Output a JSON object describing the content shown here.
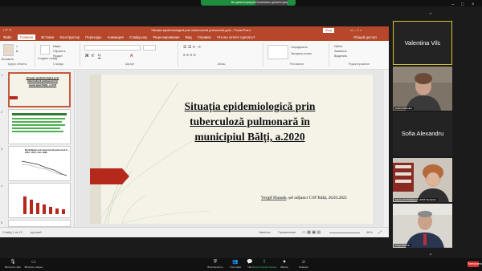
{
  "zoom": {
    "sharing_text": "Вы демонстрируете экран",
    "stop_share_label": "Остановить демонстрацию",
    "bottom_buttons": [
      {
        "icon": "mic-off-icon",
        "label": "Включить звук"
      },
      {
        "icon": "video-off-icon",
        "label": "Включить видео"
      },
      {
        "icon": "security-icon",
        "label": "Безопасность"
      },
      {
        "icon": "participants-icon",
        "label": "Участники"
      },
      {
        "icon": "chat-icon",
        "label": "Чат"
      },
      {
        "icon": "share-screen-icon",
        "label": "Демонстрация экрана"
      },
      {
        "icon": "record-icon",
        "label": "Запись"
      },
      {
        "icon": "reactions-icon",
        "label": "Реакции"
      }
    ],
    "end_label": "Завершить"
  },
  "participants": [
    {
      "name": "Valentina Vilc",
      "label": "",
      "type": "name-only",
      "active": true
    },
    {
      "name": "",
      "label": "Andrei Barbulat",
      "type": "video"
    },
    {
      "name": "Sofia Alexandru",
      "label": "",
      "type": "name-only"
    },
    {
      "name": "",
      "label": "Marina ROTARENCO, IMSP Mediclub",
      "type": "video"
    },
    {
      "name": "",
      "label": "Vergil Manole",
      "type": "video"
    }
  ],
  "ppt": {
    "window_title": "Situația epidemiologică prin tuberculoză pulmonară.pptx - PowerPoint",
    "signin": "Вход",
    "menu": [
      "Файл",
      "Главная",
      "Вставка",
      "Конструктор",
      "Переходы",
      "Анимация",
      "Слайд-шоу",
      "Рецензирование",
      "Вид",
      "Справка",
      "Что вы хотите сделать?"
    ],
    "share_label": "Общий доступ",
    "ribbon_groups": [
      "Буфер обмена",
      "Слайды",
      "Шрифт",
      "Абзац",
      "Рисование",
      "Редактирование"
    ],
    "ribbon_texts": {
      "create_slide": "Создать слайд",
      "layout": "Макет",
      "reset": "Сбросить",
      "section": "Раздел",
      "paste": "Вставить",
      "find": "Найти",
      "replace": "Заменить",
      "select": "Выделить",
      "arrange": "Упорядочить",
      "quick_styles": "Экспресс-стили"
    },
    "slide": {
      "title": "Situația epidemiologică prin tuberculoză pulmonară în municipiul Bălți, a.2020",
      "author_name": "Vergil Manole",
      "author_rest": ", șef adjunct CSP Bălți, 26.03.2021"
    },
    "thumbnails": [
      {
        "num": "1",
        "text": "Situația epidemiologică prin tuberculoză pulmonară în municipiul Bălți, a.2020"
      },
      {
        "num": "2",
        "text": ""
      },
      {
        "num": "3",
        "text": "Morbiditatea prin tuberculoză pulmonară în 2019 - 2021, mun. Bălți"
      },
      {
        "num": "4",
        "text": ""
      },
      {
        "num": "5",
        "text": ""
      }
    ],
    "status": {
      "slide_info": "Слайд 1 из 13",
      "language": "русский",
      "notes": "Заметки",
      "comments": "Примечания",
      "zoom": "46%"
    },
    "colors": {
      "accent": "#b7472a",
      "slide_arrow": "#b5281c",
      "slide_bg": "#f5f3e8"
    }
  }
}
